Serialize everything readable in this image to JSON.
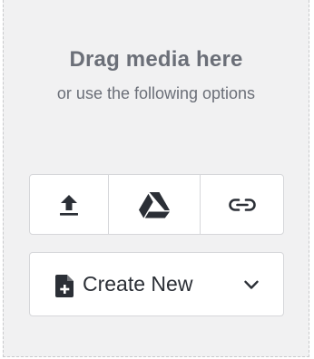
{
  "dropzone": {
    "title": "Drag media here",
    "subtitle": "or use the following options"
  },
  "sources": {
    "buttons": [
      {
        "icon": "upload-icon"
      },
      {
        "icon": "google-drive-icon"
      },
      {
        "icon": "link-icon"
      }
    ]
  },
  "create": {
    "label": "Create New",
    "icon": "file-plus-icon",
    "dropdown_icon": "chevron-down-icon"
  },
  "colors": {
    "background": "#f1f1f2",
    "heading": "#6b6f78",
    "icon": "#2b2f36",
    "border": "#d6d7da"
  }
}
